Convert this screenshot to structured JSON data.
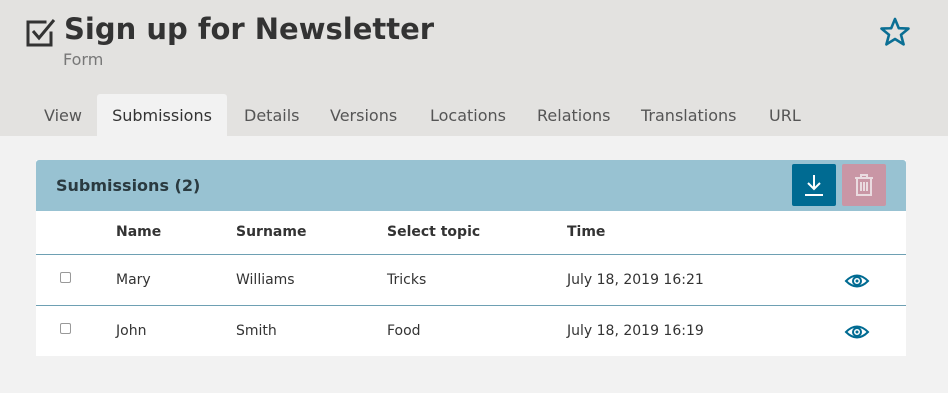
{
  "header": {
    "title": "Sign up for Newsletter",
    "subtitle": "Form"
  },
  "tabs": [
    {
      "label": "View"
    },
    {
      "label": "Submissions",
      "active": true
    },
    {
      "label": "Details"
    },
    {
      "label": "Versions"
    },
    {
      "label": "Locations"
    },
    {
      "label": "Relations"
    },
    {
      "label": "Translations"
    },
    {
      "label": "URL"
    }
  ],
  "panel": {
    "title": "Submissions (2)",
    "columns": [
      "Name",
      "Surname",
      "Select topic",
      "Time"
    ],
    "rows": [
      {
        "name": "Mary",
        "surname": "Williams",
        "topic": "Tricks",
        "time": "July 18, 2019 16:21",
        "checked": false
      },
      {
        "name": "John",
        "surname": "Smith",
        "topic": "Food",
        "time": "July 18, 2019 16:19",
        "checked": false
      }
    ],
    "actions": {
      "download_icon": "download-icon",
      "delete_icon": "trash-icon",
      "view_icon": "eye-icon"
    }
  },
  "colors": {
    "header_bg": "#e3e2e0",
    "panel_header_bg": "#98c2d2",
    "primary": "#006b92",
    "delete_disabled": "#c996a5",
    "page_bg": "#f2f2f2"
  }
}
